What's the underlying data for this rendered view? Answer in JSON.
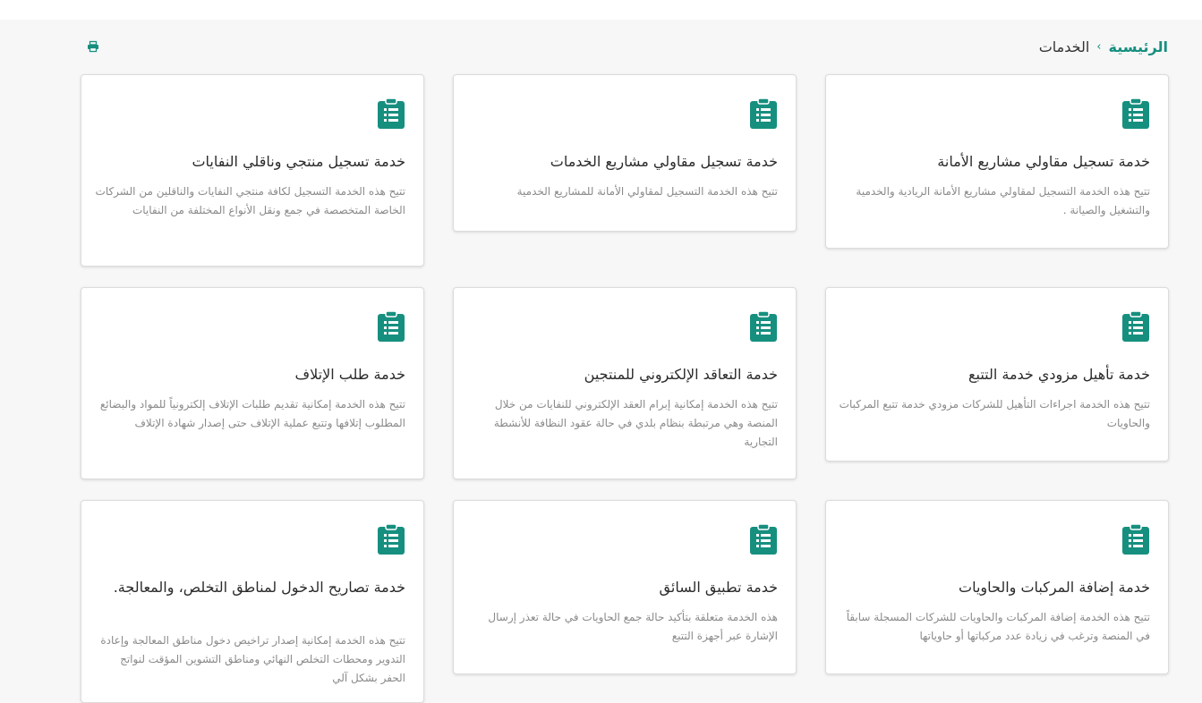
{
  "breadcrumb": {
    "home": "الرئيسية",
    "separator": "›",
    "current": "الخدمات"
  },
  "icons": {
    "card_icon": "clipboard-list-icon",
    "print_icon": "print-icon"
  },
  "colors": {
    "accent": "#168f7f",
    "text": "#2b2b2b",
    "muted": "#8a8a8a"
  },
  "services": [
    {
      "title": "خدمة تسجيل مقاولي مشاريع الأمانة",
      "description": "تتيح هذه الخدمة التسجيل لمقاولي مشاريع الأمانة الريادية والخدمية والتشغيل والصيانة ."
    },
    {
      "title": "خدمة تسجيل مقاولي مشاريع الخدمات",
      "description": "تتيح هذه الخدمة التسجيل لمقاولي الأمانة للمشاريع الخدمية"
    },
    {
      "title": "خدمة تسجيل منتجي وناقلي النفايات",
      "description": "تتيح هذه الخدمة التسجيل لكافة منتجي النفايات والناقلين من الشركات الخاصة المتخصصة في جمع ونقل الأنواع المختلفة من النفايات"
    },
    {
      "title": "خدمة تأهيل مزودي خدمة التتبع",
      "description": "تتيح هذه الخدمة اجراءات التأهيل للشركات مزودي خدمة تتبع المركبات والحاويات"
    },
    {
      "title": "خدمة التعاقد الإلكتروني للمنتجين",
      "description": "تتيح هذه الخدمة إمكانية إبرام العقد الإلكتروني للنفايات من خلال المنصة وهي مرتبطة بنظام بلدي في حالة عقود النظافة للأنشطة التجارية"
    },
    {
      "title": "خدمة طلب الإتلاف",
      "description": "تتيح هذه الخدمة إمكانية تقديم طلبات الإتلاف إلكترونياً للمواد والبضائع المطلوب إتلافها وتتبع عملية الإتلاف حتى إصدار شهادة الإتلاف"
    },
    {
      "title": "خدمة إضافة المركبات والحاويات",
      "description": "تتيح هذه الخدمة إضافة المركبات والحاويات للشركات المسجلة سابقاً في المنصة وترغب في زيادة عدد مركباتها أو حاوياتها"
    },
    {
      "title": "خدمة تطبيق السائق",
      "description": "هذه الخدمة متعلقة بتأكيد حالة جمع الحاويات في حالة تعذر إرسال الإشارة عبر أجهزة التتبع"
    },
    {
      "title": "خدمة تصاريح الدخول لمناطق التخلص، والمعالجة.",
      "description": "تتيح هذه الخدمة إمكانية إصدار تراخيص دخول مناطق المعالجة وإعادة التدوير ومحطات التخلص النهائي ومناطق التشوين المؤقت لنواتج الحفر بشكل آلي"
    }
  ]
}
